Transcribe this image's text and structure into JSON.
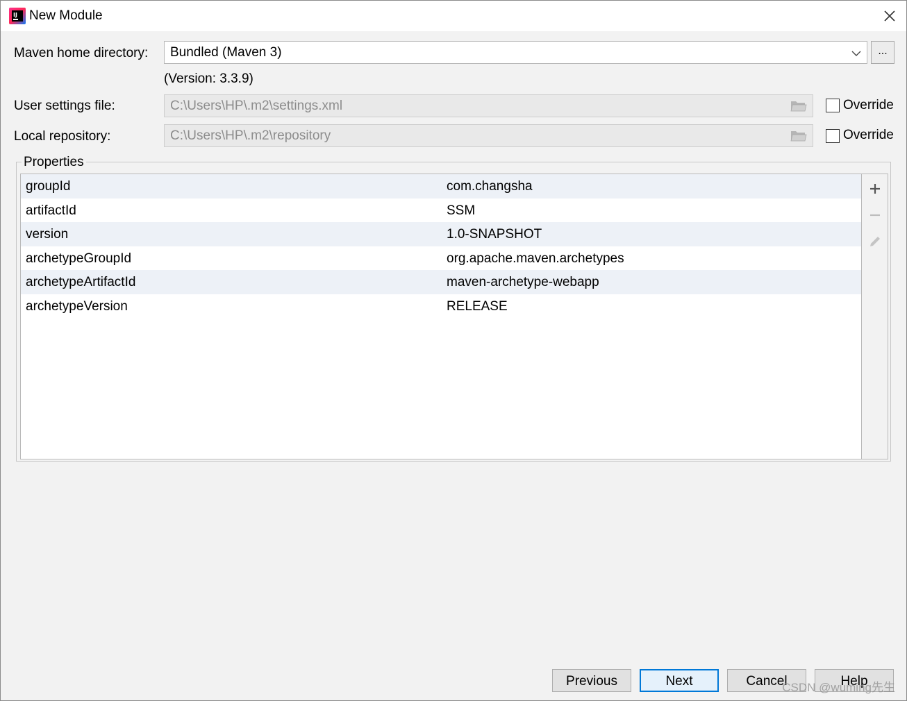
{
  "window": {
    "title": "New Module"
  },
  "form": {
    "maven_home_label": "Maven home directory:",
    "maven_home_value": "Bundled (Maven 3)",
    "browse_label": "...",
    "version_text": "(Version: 3.3.9)",
    "user_settings_label": "User settings file:",
    "user_settings_value": "C:\\Users\\HP\\.m2\\settings.xml",
    "local_repo_label": "Local repository:",
    "local_repo_value": "C:\\Users\\HP\\.m2\\repository",
    "override_label": "Override",
    "override_user_settings_checked": false,
    "override_local_repo_checked": false
  },
  "properties": {
    "title": "Properties",
    "rows": [
      {
        "key": "groupId",
        "value": "com.changsha"
      },
      {
        "key": "artifactId",
        "value": "SSM"
      },
      {
        "key": "version",
        "value": "1.0-SNAPSHOT"
      },
      {
        "key": "archetypeGroupId",
        "value": "org.apache.maven.archetypes"
      },
      {
        "key": "archetypeArtifactId",
        "value": "maven-archetype-webapp"
      },
      {
        "key": "archetypeVersion",
        "value": "RELEASE"
      }
    ],
    "tools": [
      "add-icon",
      "remove-icon",
      "edit-icon"
    ]
  },
  "buttons": {
    "previous": "Previous",
    "next": "Next",
    "cancel": "Cancel",
    "help": "Help"
  },
  "watermark": "CSDN @wuming先生",
  "colors": {
    "window_bg": "#f2f2f2",
    "row_alt_bg": "#edf1f7",
    "primary_border": "#0078d7",
    "primary_bg": "#e5f1fb"
  }
}
